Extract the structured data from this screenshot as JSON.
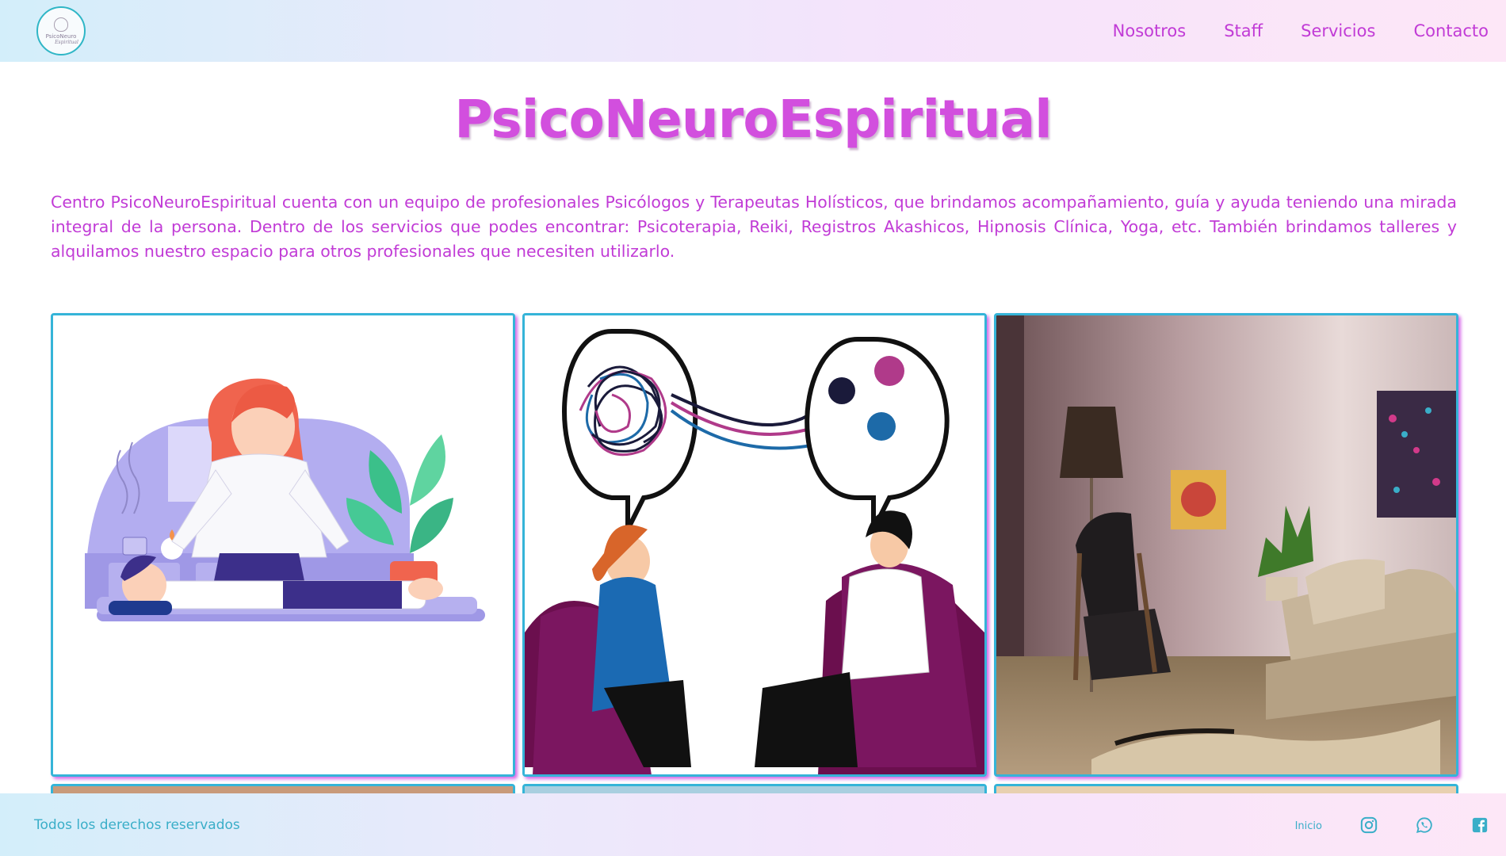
{
  "header": {
    "logo": {
      "line1": "PsicoNeuro",
      "line2": "Espiritual"
    },
    "nav": [
      "Nosotros",
      "Staff",
      "Servicios",
      "Contacto"
    ]
  },
  "main": {
    "title": "PsicoNeuroEspiritual",
    "intro": "Centro PsicoNeuroEspiritual cuenta con un equipo de profesionales Psicólogos y Terapeutas Holísticos, que brindamos acompañamiento, guía y ayuda teniendo una mirada integral de la persona. Dentro de los servicios que podes encontrar: Psicoterapia, Reiki, Registros Akashicos, Hipnosis Clínica, Yoga, etc. También brindamos talleres y alquilamos nuestro espacio para otros profesionales que necesiten utilizarlo."
  },
  "footer": {
    "copyright": "Todos los derechos reservados",
    "home_link": "Inicio",
    "social_icons": [
      "instagram-icon",
      "whatsapp-icon",
      "facebook-icon"
    ]
  },
  "colors": {
    "accent": "#c13bd6",
    "secondary": "#3aaec8",
    "card_border": "#35b4d8"
  }
}
